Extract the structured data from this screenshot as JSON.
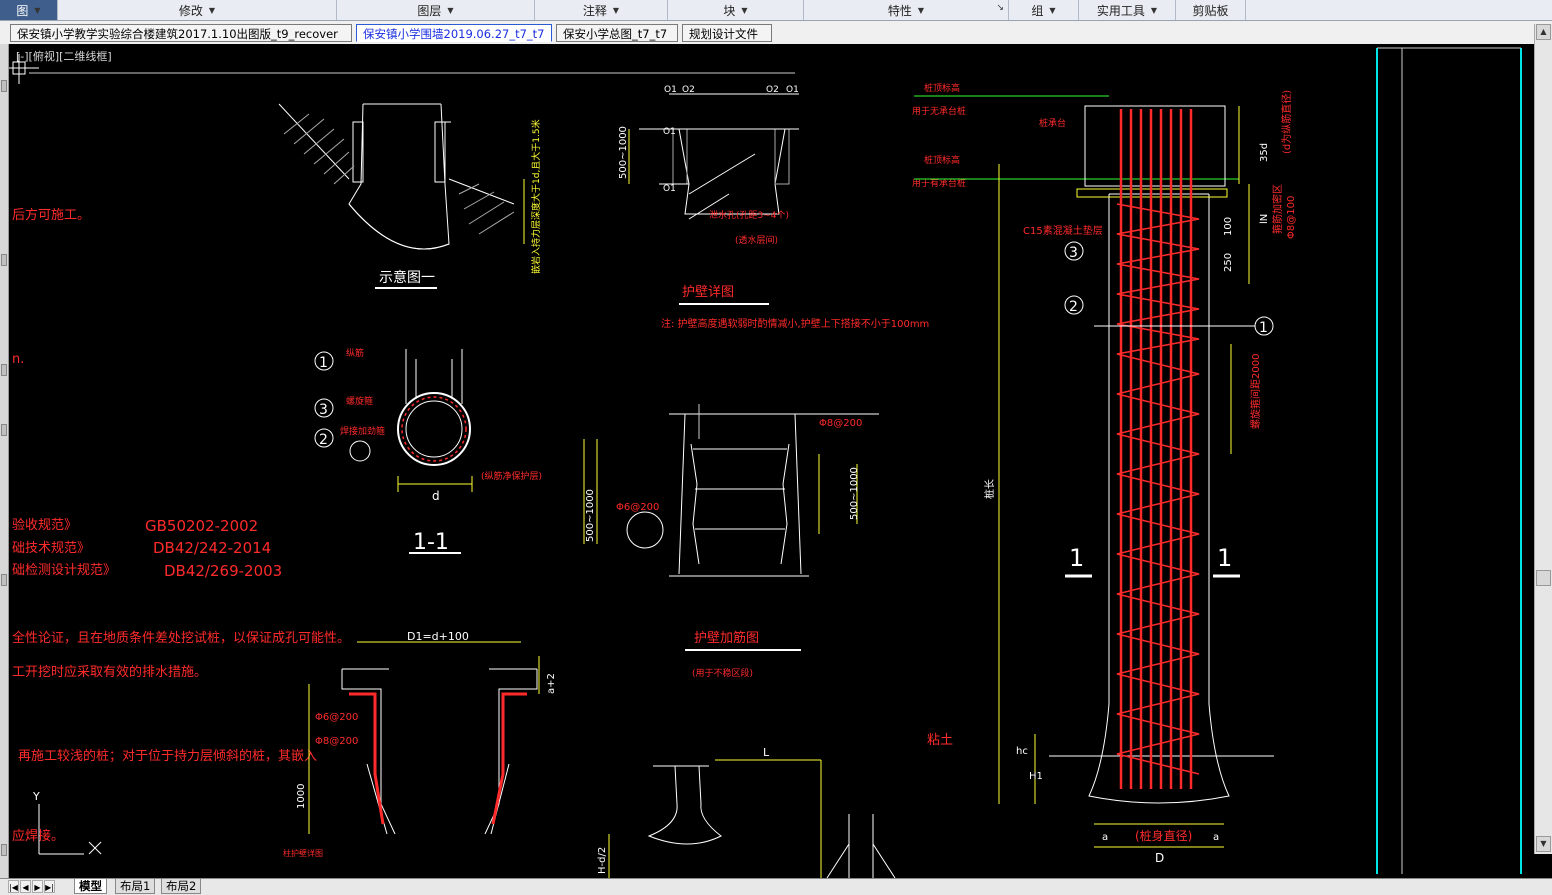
{
  "ribbon": {
    "panels": [
      {
        "label": "图",
        "has_dropdown": true
      },
      {
        "label": "修改",
        "has_dropdown": true
      },
      {
        "label": "图层",
        "has_dropdown": true
      },
      {
        "label": "注释",
        "has_dropdown": true
      },
      {
        "label": "块",
        "has_dropdown": true
      },
      {
        "label": "特性",
        "has_dropdown": true
      },
      {
        "label": "组",
        "has_dropdown": true
      },
      {
        "label": "实用工具",
        "has_dropdown": true
      },
      {
        "label": "剪贴板",
        "has_dropdown": false
      }
    ]
  },
  "doc_tabs": [
    {
      "label": "保安镇小学教学实验综合楼建筑2017.1.10出图版_t9_recover",
      "active": false
    },
    {
      "label": "保安镇小学围墙2019.06.27_t7_t7",
      "active": true
    },
    {
      "label": "保安小学总图_t7_t7",
      "active": false
    },
    {
      "label": "规划设计文件",
      "active": false
    }
  ],
  "viewport": {
    "label": "[-][俯视][二维线框]"
  },
  "drawing": {
    "left_notes": [
      "后方可施工。",
      "n.",
      "验收规范》",
      "础技术规范》",
      "础检测设计规范》",
      "全性论证，且在地质条件差处挖试桩，以保证成孔可能性。",
      "工开挖时应采取有效的排水措施。",
      "再施工较浅的桩；对于位于持力层倾斜的桩，其嵌入",
      "应焊接。"
    ],
    "codes": [
      "GB50202-2002",
      "DB42/242-2014",
      "DB42/269-2003"
    ],
    "titles": {
      "schematic": "示意图一",
      "wall_detail": "护壁详图",
      "wall_strengthen": "护壁加筋图",
      "section_11": "1-1",
      "strengthen_note": "(用于不稳区段)",
      "seepage_note": "(透水层间)",
      "water_hole": "泄水孔(孔距3~4个)",
      "wall_note": "注: 护壁高度遇软弱时酌情减小,护壁上下搭接不小于100mm",
      "cap_note": "柱护壁详图"
    },
    "pile_labels": {
      "top_elev_1": "桩顶标高",
      "no_cap": "用于无承台桩",
      "top_elev_2": "桩顶标高",
      "with_cap": "用于有承台桩",
      "cap": "桩承台",
      "c15": "C15素混凝土垫层",
      "soil": "粘土",
      "pile_diameter": "(桩身直径)",
      "D": "D",
      "d": "d",
      "a": "a",
      "L": "L",
      "anchor": "35d",
      "anchor2": "(d为纵筋直径)",
      "stirrup": "箍筋加密区",
      "phi8": "Φ8@100",
      "spiral": "螺旋箍间距2000",
      "len": "桩长",
      "n100": "100",
      "n250": "250",
      "ln": "lN",
      "sec1": "1",
      "hc": "hc",
      "h1": "H1",
      "phi8_200": "Φ8@200",
      "phi6_200": "Φ6@200",
      "phi6_200b": "Φ6@200",
      "phi8_200b": "Φ8@200",
      "r500": "500~1000",
      "r500b": "500~1000",
      "d1": "D1=d+100",
      "a2": "a+2",
      "d100": "100",
      "n1000": "1000",
      "hd2": "H-d/2"
    },
    "callouts": [
      "1",
      "2",
      "3",
      "1",
      "2",
      "3",
      "1"
    ],
    "ring_labels": [
      "纵筋",
      "螺旋箍",
      "焊接加劲箍"
    ],
    "ring_note": "(纵筋净保护层)",
    "o_labels": [
      "O1",
      "O2",
      "O2",
      "O1",
      "O1",
      "O1"
    ],
    "depth_note": "嵌岩入持力层深度大于1d,且大于1.5米",
    "wall_dim": "500~1000"
  },
  "layout_tabs": [
    {
      "label": "模型",
      "active": true
    },
    {
      "label": "布局1",
      "active": false
    },
    {
      "label": "布局2",
      "active": false
    }
  ],
  "colors": {
    "red": "#ff2b2b",
    "white": "#ffffff",
    "yellow": "#ffff33",
    "cyan": "#00e5e5",
    "green": "#33ff33",
    "ribbon": "#e9ecf2"
  }
}
